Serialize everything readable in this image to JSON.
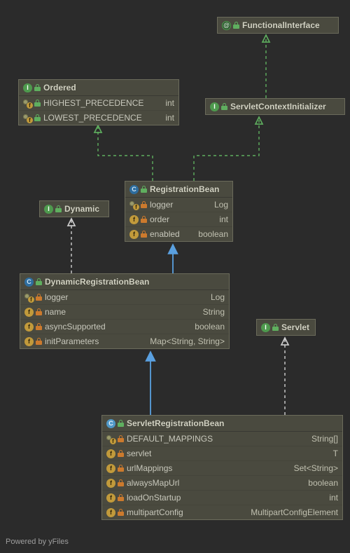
{
  "classes": {
    "functionalInterface": {
      "title": "FunctionalInterface"
    },
    "ordered": {
      "title": "Ordered",
      "rows": [
        {
          "name": "HIGHEST_PRECEDENCE",
          "type": "int"
        },
        {
          "name": "LOWEST_PRECEDENCE",
          "type": "int"
        }
      ]
    },
    "servletContextInitializer": {
      "title": "ServletContextInitializer"
    },
    "registrationBean": {
      "title": "RegistrationBean",
      "rows": [
        {
          "name": "logger",
          "type": "Log"
        },
        {
          "name": "order",
          "type": "int"
        },
        {
          "name": "enabled",
          "type": "boolean"
        }
      ]
    },
    "dynamic": {
      "title": "Dynamic"
    },
    "dynamicRegistrationBean": {
      "title": "DynamicRegistrationBean",
      "rows": [
        {
          "name": "logger",
          "type": "Log"
        },
        {
          "name": "name",
          "type": "String"
        },
        {
          "name": "asyncSupported",
          "type": "boolean"
        },
        {
          "name": "initParameters",
          "type": "Map<String, String>"
        }
      ]
    },
    "servlet": {
      "title": "Servlet"
    },
    "servletRegistrationBean": {
      "title": "ServletRegistrationBean",
      "rows": [
        {
          "name": "DEFAULT_MAPPINGS",
          "type": "String[]"
        },
        {
          "name": "servlet",
          "type": "T"
        },
        {
          "name": "urlMappings",
          "type": "Set<String>"
        },
        {
          "name": "alwaysMapUrl",
          "type": "boolean"
        },
        {
          "name": "loadOnStartup",
          "type": "int"
        },
        {
          "name": "multipartConfig",
          "type": "MultipartConfigElement"
        }
      ]
    }
  },
  "footer": "Powered by yFiles"
}
